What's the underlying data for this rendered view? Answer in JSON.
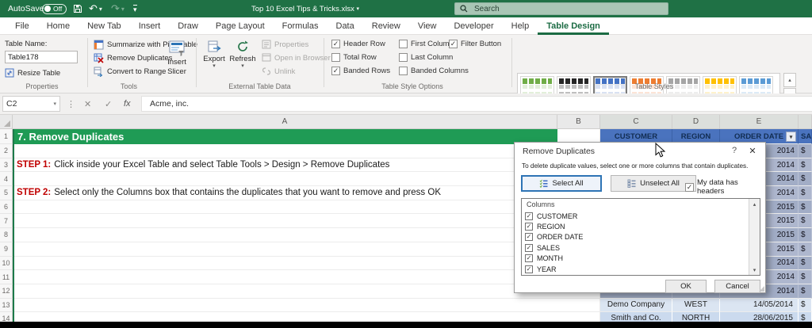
{
  "titlebar": {
    "autosave_label": "AutoSave",
    "autosave_state": "Off",
    "title": "Top 10 Excel Tips & Tricks.xlsx",
    "search_placeholder": "Search"
  },
  "icons": {
    "undo": "↶",
    "redo": "↷",
    "caret_down": "▾",
    "dots": "⋮",
    "x_mark": "✕",
    "check_mark": "✓",
    "fx": "fx",
    "scroll_up": "▴",
    "scroll_down": "▾",
    "more": "▾"
  },
  "tabs": [
    "File",
    "Home",
    "New Tab",
    "Insert",
    "Draw",
    "Page Layout",
    "Formulas",
    "Data",
    "Review",
    "View",
    "Developer",
    "Help",
    "Table Design"
  ],
  "ribbon": {
    "properties": {
      "group_label": "Properties",
      "table_name_label": "Table Name:",
      "table_name_value": "Table178",
      "resize_table": "Resize Table"
    },
    "tools": {
      "group_label": "Tools",
      "summarize": "Summarize with PivotTable",
      "remove_duplicates": "Remove Duplicates",
      "convert": "Convert to Range",
      "insert_slicer_line1": "Insert",
      "insert_slicer_line2": "Slicer"
    },
    "external": {
      "group_label": "External Table Data",
      "export": "Export",
      "refresh": "Refresh",
      "properties": "Properties",
      "open_browser": "Open in Browser",
      "unlink": "Unlink"
    },
    "style_options": {
      "group_label": "Table Style Options",
      "header_row": {
        "label": "Header Row",
        "check": "✓"
      },
      "total_row": {
        "label": "Total Row",
        "check": ""
      },
      "banded_rows": {
        "label": "Banded Rows",
        "check": "✓"
      },
      "first_column": {
        "label": "First Column",
        "check": ""
      },
      "last_column": {
        "label": "Last Column",
        "check": ""
      },
      "banded_columns": {
        "label": "Banded Columns",
        "check": ""
      },
      "filter_button": {
        "label": "Filter Button",
        "check": "✓"
      }
    },
    "styles": {
      "group_label": "Table Styles"
    }
  },
  "formula_bar": {
    "cell_ref": "C2",
    "value": "Acme, inc."
  },
  "sheet": {
    "col_headers": [
      "A",
      "B",
      "C",
      "D",
      "E"
    ],
    "row_numbers": [
      "1",
      "2",
      "3",
      "4",
      "5",
      "6",
      "7",
      "8",
      "9",
      "10",
      "11",
      "12",
      "13",
      "14"
    ],
    "row1_title": "7. Remove Duplicates",
    "table_headers": {
      "customer": "CUSTOMER",
      "region": "REGION",
      "order_date": "ORDER DATE",
      "sales": "SALES"
    },
    "step1_label": "STEP 1:",
    "step1_text": "Click inside your Excel Table and select Table Tools > Design > Remove Duplicates",
    "step2_label": "STEP 2:",
    "step2_text": "Select only the Columns box that contains the duplicates that you want to remove and press OK",
    "data_rows": [
      {
        "year": "2014",
        "sales": "$"
      },
      {
        "year": "2014",
        "sales": "$"
      },
      {
        "year": "2014",
        "sales": "$"
      },
      {
        "year": "2014",
        "sales": "$"
      },
      {
        "year": "2015",
        "sales": "$"
      },
      {
        "year": "2015",
        "sales": "$"
      },
      {
        "year": "2015",
        "sales": "$"
      },
      {
        "year": "2015",
        "sales": "$"
      },
      {
        "year": "2014",
        "sales": "$"
      },
      {
        "year": "2014",
        "sales": "$"
      },
      {
        "year": "2014",
        "sales": "$"
      }
    ],
    "bottom_rows": [
      {
        "customer": "Demo Company",
        "region": "WEST",
        "date": "14/05/2014",
        "sales": "$"
      },
      {
        "customer": "Smith and Co.",
        "region": "NORTH",
        "date": "28/06/2015",
        "sales": "$"
      }
    ]
  },
  "dialog": {
    "title": "Remove Duplicates",
    "help": "?",
    "close": "✕",
    "instruction": "To delete duplicate values, select one or more columns that contain duplicates.",
    "select_all": "Select All",
    "unselect_all": "Unselect All",
    "headers_check": "✓",
    "headers_label": "My data has headers",
    "columns_label": "Columns",
    "columns": [
      {
        "label": "CUSTOMER",
        "check": "✓"
      },
      {
        "label": "REGION",
        "check": "✓"
      },
      {
        "label": "ORDER DATE",
        "check": "✓"
      },
      {
        "label": "SALES",
        "check": "✓"
      },
      {
        "label": "MONTH",
        "check": "✓"
      },
      {
        "label": "YEAR",
        "check": "✓"
      }
    ],
    "ok": "OK",
    "cancel": "Cancel"
  },
  "colors": {
    "excel_green": "#1f7145",
    "row1_green": "#1f9b55",
    "table_header_blue": "#4a73be",
    "selection_slate": "#a2adc6",
    "step_red": "#c00000"
  }
}
